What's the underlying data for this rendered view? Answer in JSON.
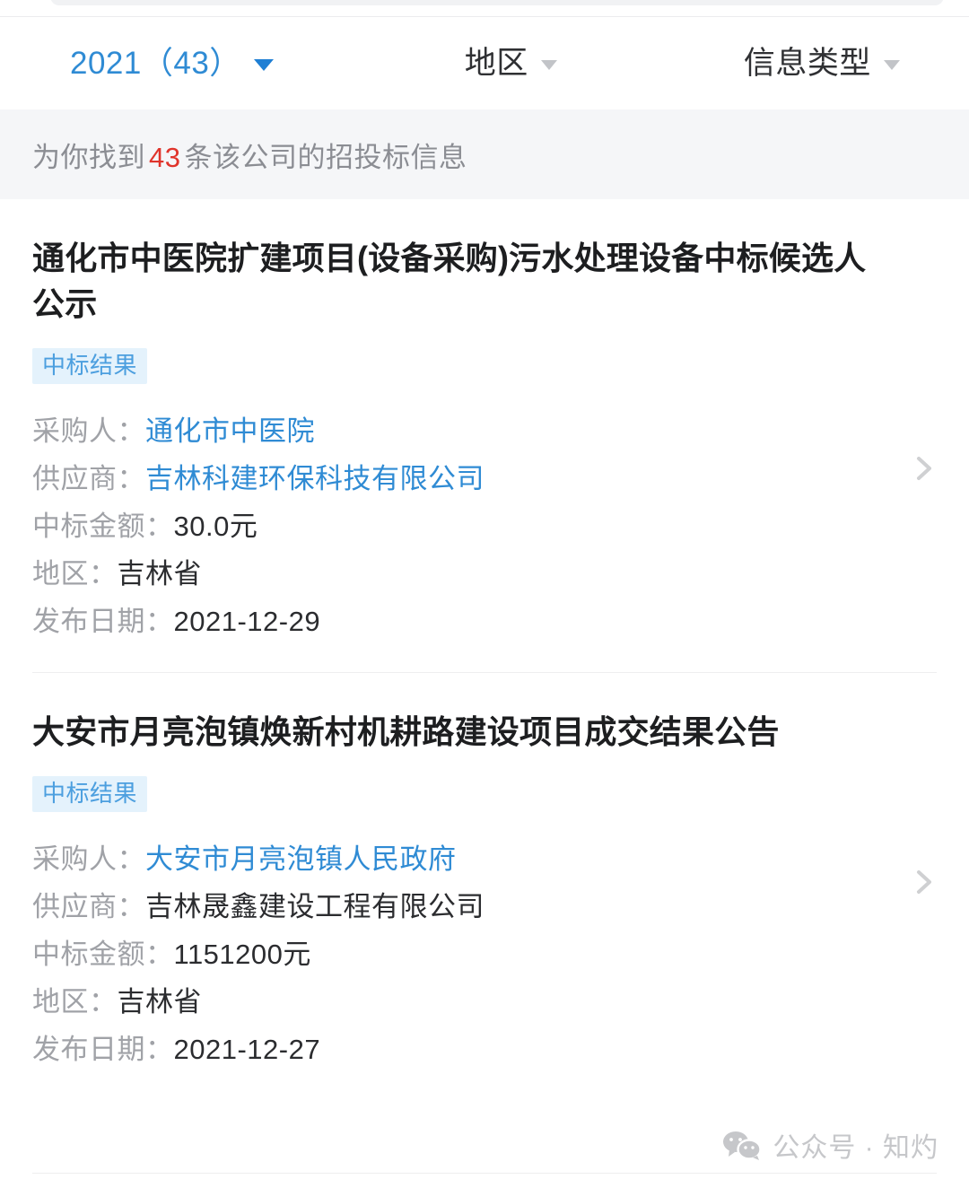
{
  "top": {
    "strip_label": ""
  },
  "filters": [
    {
      "label": "2021（43）",
      "name": "year",
      "active": true,
      "caret": "caret-down-icon"
    },
    {
      "label": "地区",
      "name": "region",
      "active": false,
      "caret": "caret-down-icon"
    },
    {
      "label": "信息类型",
      "name": "type",
      "active": false,
      "caret": "caret-down-icon"
    }
  ],
  "summary": {
    "prefix": "为你找到",
    "count": "43",
    "suffix": "条该公司的招投标信息"
  },
  "results": [
    {
      "title": "通化市中医院扩建项目(设备采购)污水处理设备中标候选人公示",
      "badge": "中标结果",
      "rows": [
        {
          "label": "采购人：",
          "value": "通化市中医院",
          "link": true
        },
        {
          "label": "供应商：",
          "value": "吉林科建环保科技有限公司",
          "link": true
        },
        {
          "label": "中标金额：",
          "value": "30.0元",
          "link": false
        },
        {
          "label": "地区：",
          "value": "吉林省",
          "link": false
        },
        {
          "label": "发布日期：",
          "value": "2021-12-29",
          "link": false
        }
      ],
      "chevron": "chevron-right-icon"
    },
    {
      "title": "大安市月亮泡镇焕新村机耕路建设项目成交结果公告",
      "badge": "中标结果",
      "rows": [
        {
          "label": "采购人：",
          "value": "大安市月亮泡镇人民政府",
          "link": true
        },
        {
          "label": "供应商：",
          "value": "吉林晟鑫建设工程有限公司",
          "link": false
        },
        {
          "label": "中标金额：",
          "value": "1151200元",
          "link": false
        },
        {
          "label": "地区：",
          "value": "吉林省",
          "link": false
        },
        {
          "label": "发布日期：",
          "value": "2021-12-27",
          "link": false
        }
      ],
      "chevron": "chevron-right-icon"
    }
  ],
  "watermark": {
    "icon": "wechat-icon",
    "text": "公众号 · 知灼"
  },
  "colors": {
    "link_blue": "#2f8bd4",
    "accent_blue": "#1f7fd4",
    "badge_bg": "#e4f2fc",
    "badge_text": "#4c9fdf",
    "count_red": "#e0342b",
    "banner_bg": "#f5f6f8",
    "label_gray": "#a0a2a7",
    "value_dark": "#2b2c2f",
    "watermark_gray": "#c6c7ca"
  }
}
